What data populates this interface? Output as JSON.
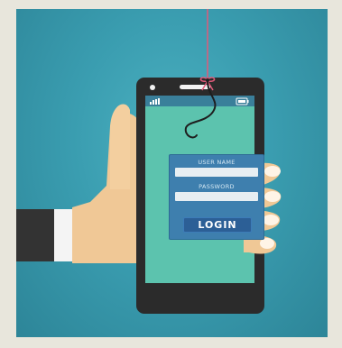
{
  "illustration": {
    "subject": "phishing",
    "icons": [
      "hand-holding-phone",
      "fishing-hook",
      "signal-bars-icon",
      "battery-icon"
    ]
  },
  "login_form": {
    "username_label": "USER NAME",
    "username_value": "",
    "password_label": "PASSWORD",
    "password_value": "",
    "login_button": "LOGIN"
  },
  "colors": {
    "background": "#3a9db0",
    "phone_body": "#2b2b2b",
    "phone_screen": "#5cc3ae",
    "form_panel": "#3e7fae",
    "button": "#2c5f96",
    "fishing_line": "#e05a7a",
    "skin": "#f0c896",
    "sleeve": "#333333"
  }
}
